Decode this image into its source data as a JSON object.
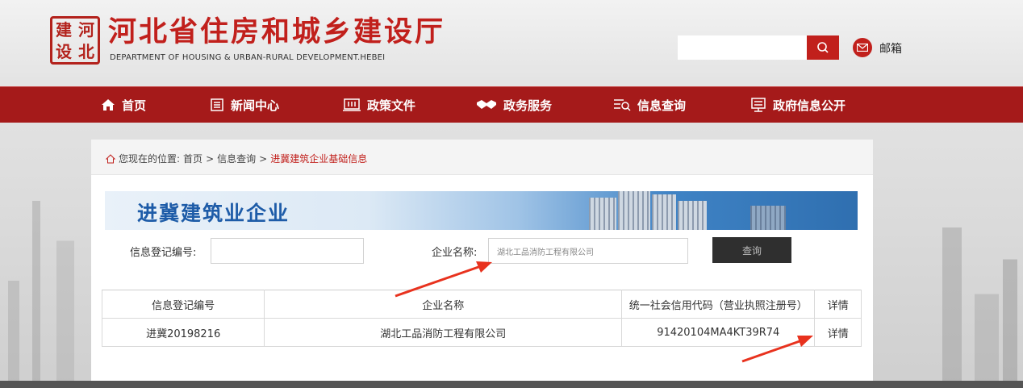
{
  "header": {
    "logo_chars": [
      "建",
      "河",
      "设",
      "北"
    ],
    "title": "河北省住房和城乡建设厅",
    "subtitle": "DEPARTMENT OF HOUSING & URBAN-RURAL DEVELOPMENT.HEBEI",
    "search_placeholder": "",
    "mail_label": "邮箱"
  },
  "nav": {
    "items": [
      {
        "label": "首页",
        "icon": "home-icon"
      },
      {
        "label": "新闻中心",
        "icon": "news-icon"
      },
      {
        "label": "政策文件",
        "icon": "policy-icon"
      },
      {
        "label": "政务服务",
        "icon": "handshake-icon"
      },
      {
        "label": "信息查询",
        "icon": "query-list-icon"
      },
      {
        "label": "政府信息公开",
        "icon": "disclosure-icon"
      }
    ]
  },
  "breadcrumb": {
    "prefix": "您现在的位置:",
    "items": [
      "首页",
      "信息查询"
    ],
    "separator": ">",
    "current": "进冀建筑企业基础信息"
  },
  "banner": {
    "title": "进冀建筑业企业"
  },
  "form": {
    "reg_no_label": "信息登记编号:",
    "reg_no_value": "",
    "company_label": "企业名称:",
    "company_value": "湖北工品消防工程有限公司",
    "query_button": "查询"
  },
  "table": {
    "columns": [
      "信息登记编号",
      "企业名称",
      "统一社会信用代码（营业执照注册号）",
      "详情"
    ],
    "rows": [
      {
        "reg_no": "进冀20198216",
        "company": "湖北工品消防工程有限公司",
        "credit_code": "91420104MA4KT39R74",
        "detail": "详情"
      }
    ]
  },
  "colors": {
    "brand_red": "#c1201c",
    "nav_red": "#a51a1a",
    "banner_blue": "#1e5ca8",
    "annotation_arrow": "#e8321e"
  }
}
